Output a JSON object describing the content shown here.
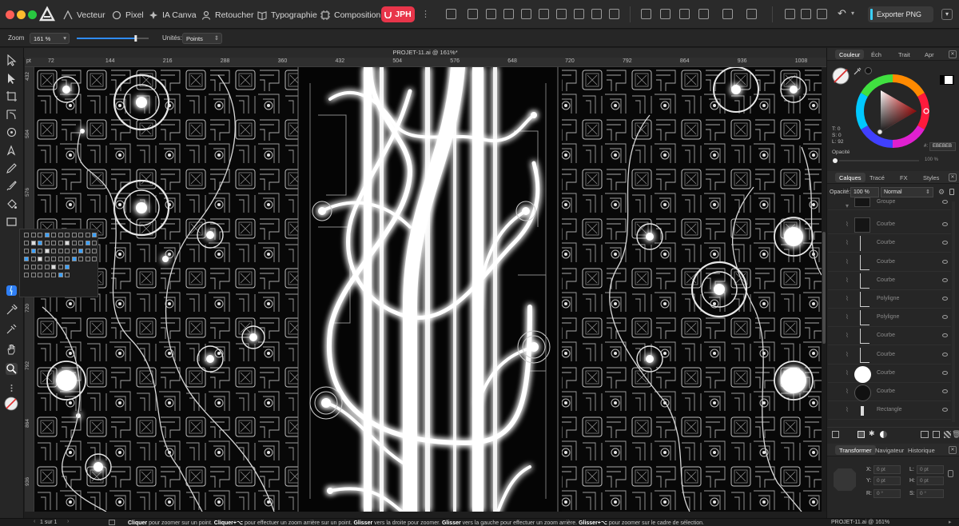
{
  "window": {
    "traffic_colors": [
      "#ff5f57",
      "#febc2e",
      "#28c840"
    ]
  },
  "toolbar": {
    "personas": [
      "Vecteur",
      "Pixel",
      "IA Canva",
      "Retoucher",
      "Typographie",
      "Composition"
    ],
    "active_persona": "JPH",
    "export_label": "Exporter PNG"
  },
  "context": {
    "zoom_label": "Zoom",
    "zoom_value": "161 %",
    "zoom_slider_fraction": 0.82,
    "units_label": "Unités:",
    "units_value": "Points"
  },
  "document": {
    "title": "PROJET-11.ai @ 161%*"
  },
  "rulers": {
    "unit": "pt",
    "top": [
      "72",
      "144",
      "216",
      "288",
      "360",
      "432",
      "504",
      "576",
      "648",
      "720",
      "792",
      "864",
      "936",
      "1008"
    ],
    "left": [
      "432",
      "504",
      "576",
      "648",
      "720",
      "792",
      "864",
      "936"
    ]
  },
  "color_panel": {
    "tabs": [
      "Couleur",
      "Éch",
      "Trait",
      "Apr"
    ],
    "hue_label": "T: 0",
    "sat_label": "S: 0",
    "lum_label": "L: 92",
    "hex": "EBEBEB",
    "opacity_label": "Opacité",
    "opacity_value": "100 %"
  },
  "layers_panel": {
    "tabs": [
      "Calques",
      "Tracé",
      "FX",
      "Styles"
    ],
    "opacity_label": "Opacité:",
    "opacity_value": "100 %",
    "blend_mode": "Normal",
    "layers": [
      {
        "name": "Groupe",
        "thumb": "group"
      },
      {
        "name": "Courbe",
        "thumb": "dark"
      },
      {
        "name": "Courbe",
        "thumb": "line"
      },
      {
        "name": "Courbe",
        "thumb": "hook"
      },
      {
        "name": "Courbe",
        "thumb": "corner"
      },
      {
        "name": "Polyligne",
        "thumb": "poly"
      },
      {
        "name": "Polyligne",
        "thumb": "poly"
      },
      {
        "name": "Courbe",
        "thumb": "step"
      },
      {
        "name": "Courbe",
        "thumb": "hook"
      },
      {
        "name": "Courbe",
        "thumb": "white-circle"
      },
      {
        "name": "Courbe",
        "thumb": "dark-circle"
      },
      {
        "name": "Rectangle",
        "thumb": "rect"
      }
    ]
  },
  "transform_panel": {
    "tabs": [
      "Transformer",
      "Navigateur",
      "Historique"
    ],
    "x_label": "X:",
    "x_value": "0 pt",
    "y_label": "Y:",
    "y_value": "0 pt",
    "l_label": "L:",
    "l_value": "0 pt",
    "h_label": "H:",
    "h_value": "0 pt",
    "r_label": "R:",
    "r_value": "0 °",
    "s_label": "S:",
    "s_value": "0 °"
  },
  "status": {
    "page": "1 sur 1",
    "hint_parts": [
      {
        "bold": true,
        "text": "Cliquer"
      },
      {
        "bold": false,
        "text": " pour zoomer sur un point. "
      },
      {
        "bold": true,
        "text": "Cliquer+⌥"
      },
      {
        "bold": false,
        "text": " pour effectuer un zoom arrière sur un point. "
      },
      {
        "bold": true,
        "text": "Glisser"
      },
      {
        "bold": false,
        "text": " vers la droite pour zoomer. "
      },
      {
        "bold": true,
        "text": "Glisser"
      },
      {
        "bold": false,
        "text": " vers la gauche pour effectuer un zoom arrière. "
      },
      {
        "bold": true,
        "text": "Glisser+⌥"
      },
      {
        "bold": false,
        "text": " pour zoomer sur le cadre de sélection."
      }
    ],
    "doc": "PROJET-11.ai @ 161%"
  },
  "icons": {
    "tools": [
      "move-tool-icon",
      "node-tool-icon",
      "artboard-tool-icon",
      "corner-tool-icon",
      "shape-builder-icon",
      "pen-tool-icon",
      "pencil-tool-icon",
      "vector-brush-icon",
      "fill-tool-icon",
      "rectangle-tool-icon",
      "text-tool-icon",
      "finder-icon",
      "color-picker-icon",
      "hand-tool-icon",
      "zoom-tool-icon",
      "fill-stroke-icon"
    ]
  }
}
